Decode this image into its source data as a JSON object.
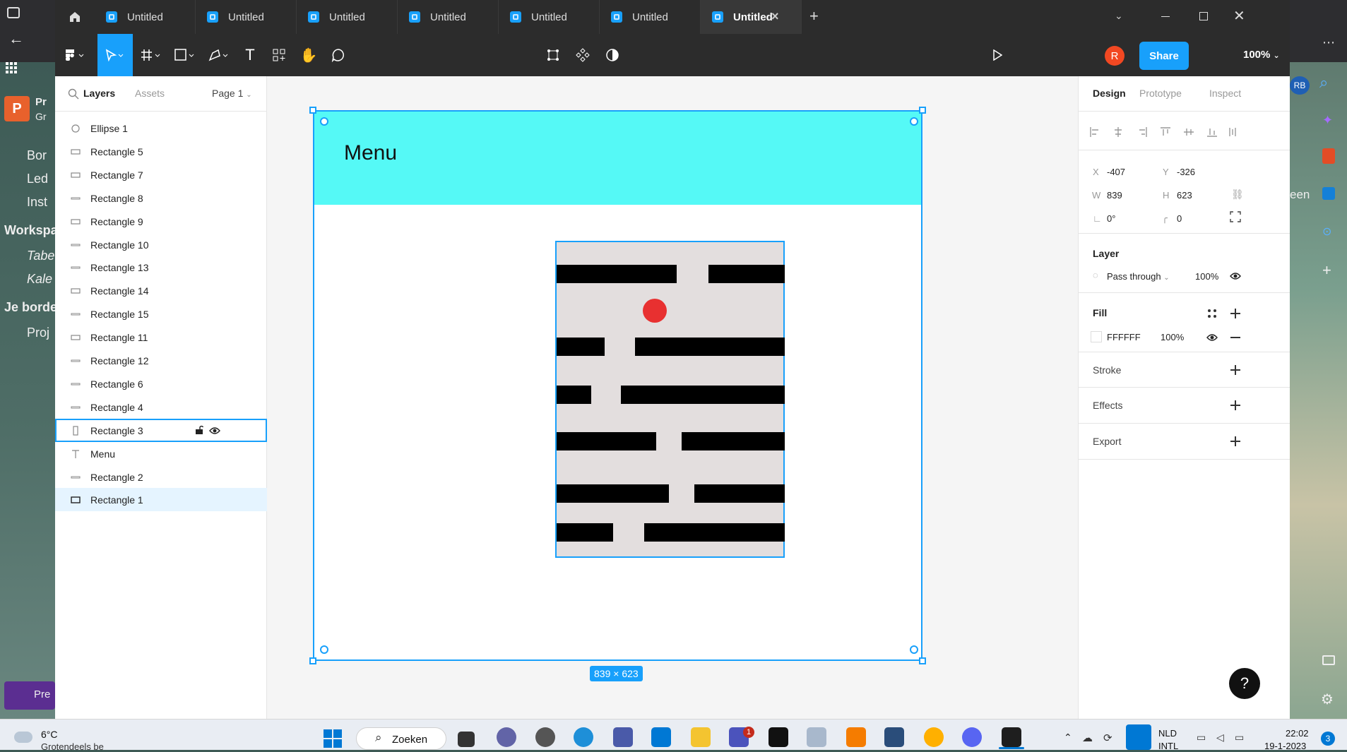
{
  "window": {
    "tabs": [
      {
        "label": "Untitled",
        "active": false
      },
      {
        "label": "Untitled",
        "active": false
      },
      {
        "label": "Untitled",
        "active": false
      },
      {
        "label": "Untitled",
        "active": false
      },
      {
        "label": "Untitled",
        "active": false
      },
      {
        "label": "Untitled",
        "active": false
      },
      {
        "label": "Untitled",
        "active": true
      }
    ],
    "new_tab_label": "+",
    "close_tab_label": "×"
  },
  "toolbar": {
    "avatar_initial": "R",
    "share_label": "Share",
    "zoom_label": "100%"
  },
  "left_panel": {
    "tabs": [
      "Layers",
      "Assets"
    ],
    "page_label": "Page 1",
    "layers": [
      {
        "name": "Ellipse 1",
        "type": "ellipse"
      },
      {
        "name": "Rectangle 5",
        "type": "rect"
      },
      {
        "name": "Rectangle 7",
        "type": "rect"
      },
      {
        "name": "Rectangle 8",
        "type": "line"
      },
      {
        "name": "Rectangle 9",
        "type": "rect"
      },
      {
        "name": "Rectangle 10",
        "type": "line"
      },
      {
        "name": "Rectangle 13",
        "type": "line"
      },
      {
        "name": "Rectangle 14",
        "type": "rect"
      },
      {
        "name": "Rectangle 15",
        "type": "line"
      },
      {
        "name": "Rectangle 11",
        "type": "rect"
      },
      {
        "name": "Rectangle 12",
        "type": "line"
      },
      {
        "name": "Rectangle 6",
        "type": "line"
      },
      {
        "name": "Rectangle 4",
        "type": "line"
      },
      {
        "name": "Rectangle 3",
        "type": "vrect",
        "hovered": true
      },
      {
        "name": "Menu",
        "type": "text"
      },
      {
        "name": "Rectangle 2",
        "type": "line"
      },
      {
        "name": "Rectangle 1",
        "type": "frame",
        "selected": true
      }
    ]
  },
  "canvas": {
    "frame_title": "Menu",
    "size_badge": "839 × 623",
    "colors": {
      "header": "#55f9f6",
      "maze_bg": "#e3dede",
      "ball": "#e83030",
      "selection": "#18a0fb"
    }
  },
  "right_panel": {
    "tabs": [
      "Design",
      "Prototype",
      "Inspect"
    ],
    "x_label": "X",
    "x_value": "-407",
    "y_label": "Y",
    "y_value": "-326",
    "w_label": "W",
    "w_value": "839",
    "h_label": "H",
    "h_value": "623",
    "rotation_value": "0°",
    "radius_value": "0",
    "layer_title": "Layer",
    "blend_mode": "Pass through",
    "layer_opacity": "100%",
    "fill_title": "Fill",
    "fill_hex": "FFFFFF",
    "fill_opacity": "100%",
    "stroke_title": "Stroke",
    "effects_title": "Effects",
    "export_title": "Export",
    "help_label": "?"
  },
  "background": {
    "left_fragments": [
      "Pr",
      "Gr",
      "Bor",
      "Led",
      "Inst",
      "Workspa",
      "Tabe",
      "Kale",
      "Je border",
      "Proj",
      "Pre"
    ],
    "right_fragments": [
      "RB",
      "een"
    ]
  },
  "taskbar": {
    "weather_temp": "6°C",
    "weather_desc": "Grotendeels be",
    "search_label": "Zoeken",
    "lang_top": "NLD",
    "lang_bottom": "INTL",
    "time": "22:02",
    "date": "19-1-2023",
    "notification_count": "3",
    "teams_badge": "1"
  }
}
